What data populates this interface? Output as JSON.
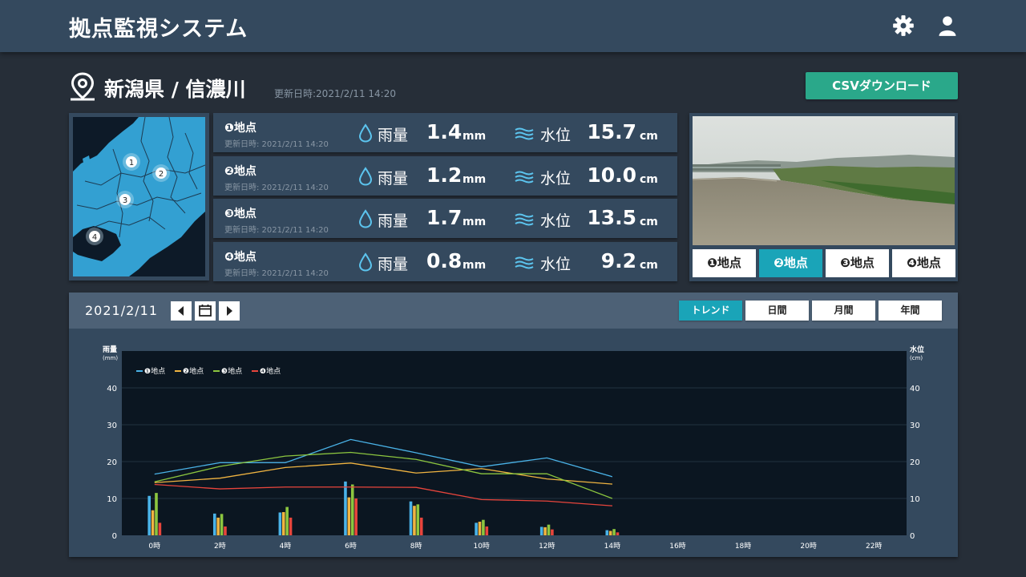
{
  "app": {
    "title": "拠点監視システム"
  },
  "location": {
    "title": "新潟県 / 信濃川",
    "updated": "更新日時:2021/2/11 14:20"
  },
  "csv_button": "CSVダウンロード",
  "rain_label": "雨量",
  "level_label": "水位",
  "rain_unit": "mm",
  "level_unit": "cm",
  "stations": [
    {
      "name": "❶地点",
      "updated": "更新日時: 2021/2/11 14:20",
      "rain": "1.4",
      "level": "15.7"
    },
    {
      "name": "❷地点",
      "updated": "更新日時: 2021/2/11 14:20",
      "rain": "1.2",
      "level": "10.0"
    },
    {
      "name": "❸地点",
      "updated": "更新日時: 2021/2/11 14:20",
      "rain": "1.7",
      "level": "13.5"
    },
    {
      "name": "❹地点",
      "updated": "更新日時: 2021/2/11 14:20",
      "rain": "0.8",
      "level": "9.2"
    }
  ],
  "map_markers": [
    "1",
    "2",
    "3",
    "4"
  ],
  "camera": {
    "buttons": [
      "❶地点",
      "❷地点",
      "❸地点",
      "❹地点"
    ],
    "active": 1
  },
  "chart_header": {
    "date": "2021/2/11",
    "views": [
      "トレンド",
      "日間",
      "月間",
      "年間"
    ],
    "active_view": 0
  },
  "colors": {
    "series1": "#4ab3e8",
    "series2": "#f0b441",
    "series3": "#8cc63f",
    "series4": "#e8453c",
    "accent": "#1aa4b8",
    "csv": "#2aa88a"
  },
  "icons": [
    "gear-icon",
    "user-icon",
    "location-pin-icon",
    "water-drop-icon",
    "water-wave-icon",
    "arrow-left-icon",
    "calendar-icon",
    "arrow-right-icon"
  ],
  "chart_data": {
    "type": "bar",
    "x": [
      "0時",
      "2時",
      "4時",
      "6時",
      "8時",
      "10時",
      "12時",
      "14時",
      "16時",
      "18時",
      "20時",
      "22時"
    ],
    "ylabel_left": "雨量",
    "ylabel_left_unit": "(mm)",
    "ylabel_right": "水位",
    "ylabel_right_unit": "(cm)",
    "ylim": [
      0,
      50
    ],
    "yticks": [
      0,
      10,
      20,
      30,
      40
    ],
    "legend_position": "top-left",
    "grid": true,
    "series": [
      {
        "name": "❶地点",
        "rain": [
          10.7,
          5.9,
          6.2,
          14.6,
          9.2,
          3.4,
          2.3,
          1.4
        ],
        "level": [
          16.6,
          19.7,
          19.7,
          26.0,
          22.4,
          18.6,
          21.0,
          15.9
        ]
      },
      {
        "name": "❷地点",
        "rain": [
          6.8,
          4.8,
          6.3,
          10.3,
          8.0,
          3.7,
          2.2,
          1.2
        ],
        "level": [
          14.3,
          15.5,
          18.4,
          19.6,
          16.9,
          18.1,
          15.3,
          13.9
        ]
      },
      {
        "name": "❸地点",
        "rain": [
          11.5,
          5.8,
          7.7,
          13.8,
          8.4,
          4.2,
          2.9,
          1.7
        ],
        "level": [
          14.5,
          18.7,
          21.5,
          22.5,
          20.6,
          16.7,
          16.7,
          10.0
        ]
      },
      {
        "name": "❹地点",
        "rain": [
          3.4,
          2.4,
          4.8,
          10.0,
          4.8,
          2.4,
          1.6,
          0.8
        ],
        "level": [
          13.8,
          12.6,
          13.1,
          13.1,
          13.0,
          9.7,
          9.3,
          8.0
        ]
      }
    ]
  }
}
